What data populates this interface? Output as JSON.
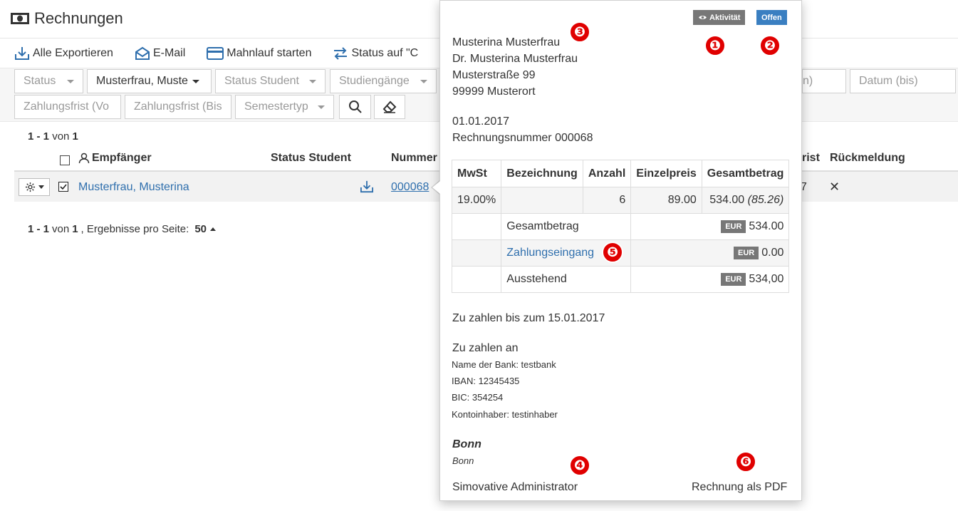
{
  "page": {
    "title": "Rechnungen"
  },
  "toolbar": {
    "export_all": "Alle Exportieren",
    "email": "E-Mail",
    "dunning": "Mahnlauf starten",
    "status_on": "Status auf \"C"
  },
  "filters": {
    "status": "Status",
    "recipient": "Musterfrau, Muste",
    "status_student": "Status Student",
    "study_programs": "Studiengänge",
    "date_from_partial": "n)",
    "date_to": "Datum (bis)",
    "payment_due_from": "Zahlungsfrist (Vo",
    "payment_due_to": "Zahlungsfrist (Bis",
    "semester_type": "Semestertyp"
  },
  "table": {
    "pager_top": {
      "range": "1 - 1",
      "of": "von",
      "total": "1"
    },
    "headers": {
      "recipient": "Empfänger",
      "status_student": "Status Student",
      "number": "Nummer",
      "due_partial": "rist",
      "feedback": "Rückmeldung"
    },
    "rows": [
      {
        "recipient": "Musterfrau, Musterina",
        "number": "000068",
        "due_partial": "7",
        "feedback": "✕"
      }
    ],
    "pager_bottom": {
      "range": "1 - 1",
      "of": "von",
      "total": "1",
      "per_page_label": ", Ergebnisse pro Seite:",
      "per_page": "50"
    }
  },
  "popover": {
    "activity_badge": "Aktivität",
    "status_badge": "Offen",
    "recipient_link": "Musterina Musterfrau",
    "address": {
      "name": "Dr. Musterina Musterfrau",
      "street": "Musterstraße 99",
      "city": "99999 Musterort"
    },
    "date": "01.01.2017",
    "invoice_number": "Rechnungsnummer 000068",
    "invoice_table": {
      "headers": [
        "MwSt",
        "Bezeichnung",
        "Anzahl",
        "Einzelpreis",
        "Gesamtbetrag"
      ],
      "row": {
        "vat": "19.00%",
        "description": "",
        "quantity": "6",
        "unit_price": "89.00",
        "total": "534.00",
        "total_vat": "(85.26)"
      },
      "currency": "EUR",
      "summary_total_label": "Gesamtbetrag",
      "summary_total_value": "534.00",
      "payment_label": "Zahlungseingang",
      "payment_value": "0.00",
      "outstanding_label": "Ausstehend",
      "outstanding_value": "534,00"
    },
    "due_text": "Zu zahlen bis zum 15.01.2017",
    "pay_to_heading": "Zu zahlen an",
    "bank_name": "Name der Bank: testbank",
    "iban": "IBAN: 12345435",
    "bic": "BIC: 354254",
    "account_holder": "Kontoinhaber: testinhaber",
    "location_bold": "Bonn",
    "location": "Bonn",
    "admin_link": "Simovative Administrator",
    "pdf_link": "Rechnung als PDF"
  },
  "markers": [
    "❶",
    "❷",
    "❸",
    "❹",
    "❺",
    "❻"
  ],
  "colors": {
    "link": "#2f6fad",
    "badge_gray": "#777777",
    "badge_blue": "#3a7fc1",
    "marker_red": "#e00000"
  }
}
